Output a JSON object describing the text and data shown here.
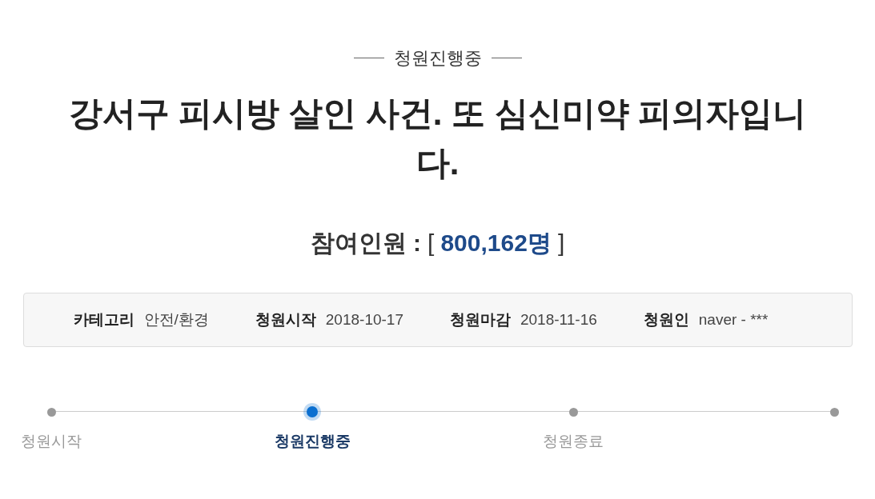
{
  "status_label": "청원진행중",
  "title": "강서구 피시방 살인 사건. 또 심신미약 피의자입니다.",
  "participants": {
    "label": "참여인원 :",
    "open": "[",
    "count": "800,162명",
    "close": "]"
  },
  "info": [
    {
      "label": "카테고리",
      "value": "안전/환경"
    },
    {
      "label": "청원시작",
      "value": "2018-10-17"
    },
    {
      "label": "청원마감",
      "value": "2018-11-16"
    },
    {
      "label": "청원인",
      "value": "naver - ***"
    }
  ],
  "steps": [
    {
      "label": "청원시작",
      "selected": false
    },
    {
      "label": "청원진행중",
      "selected": true
    },
    {
      "label": "청원종료",
      "selected": false
    },
    {
      "selected": false
    }
  ]
}
